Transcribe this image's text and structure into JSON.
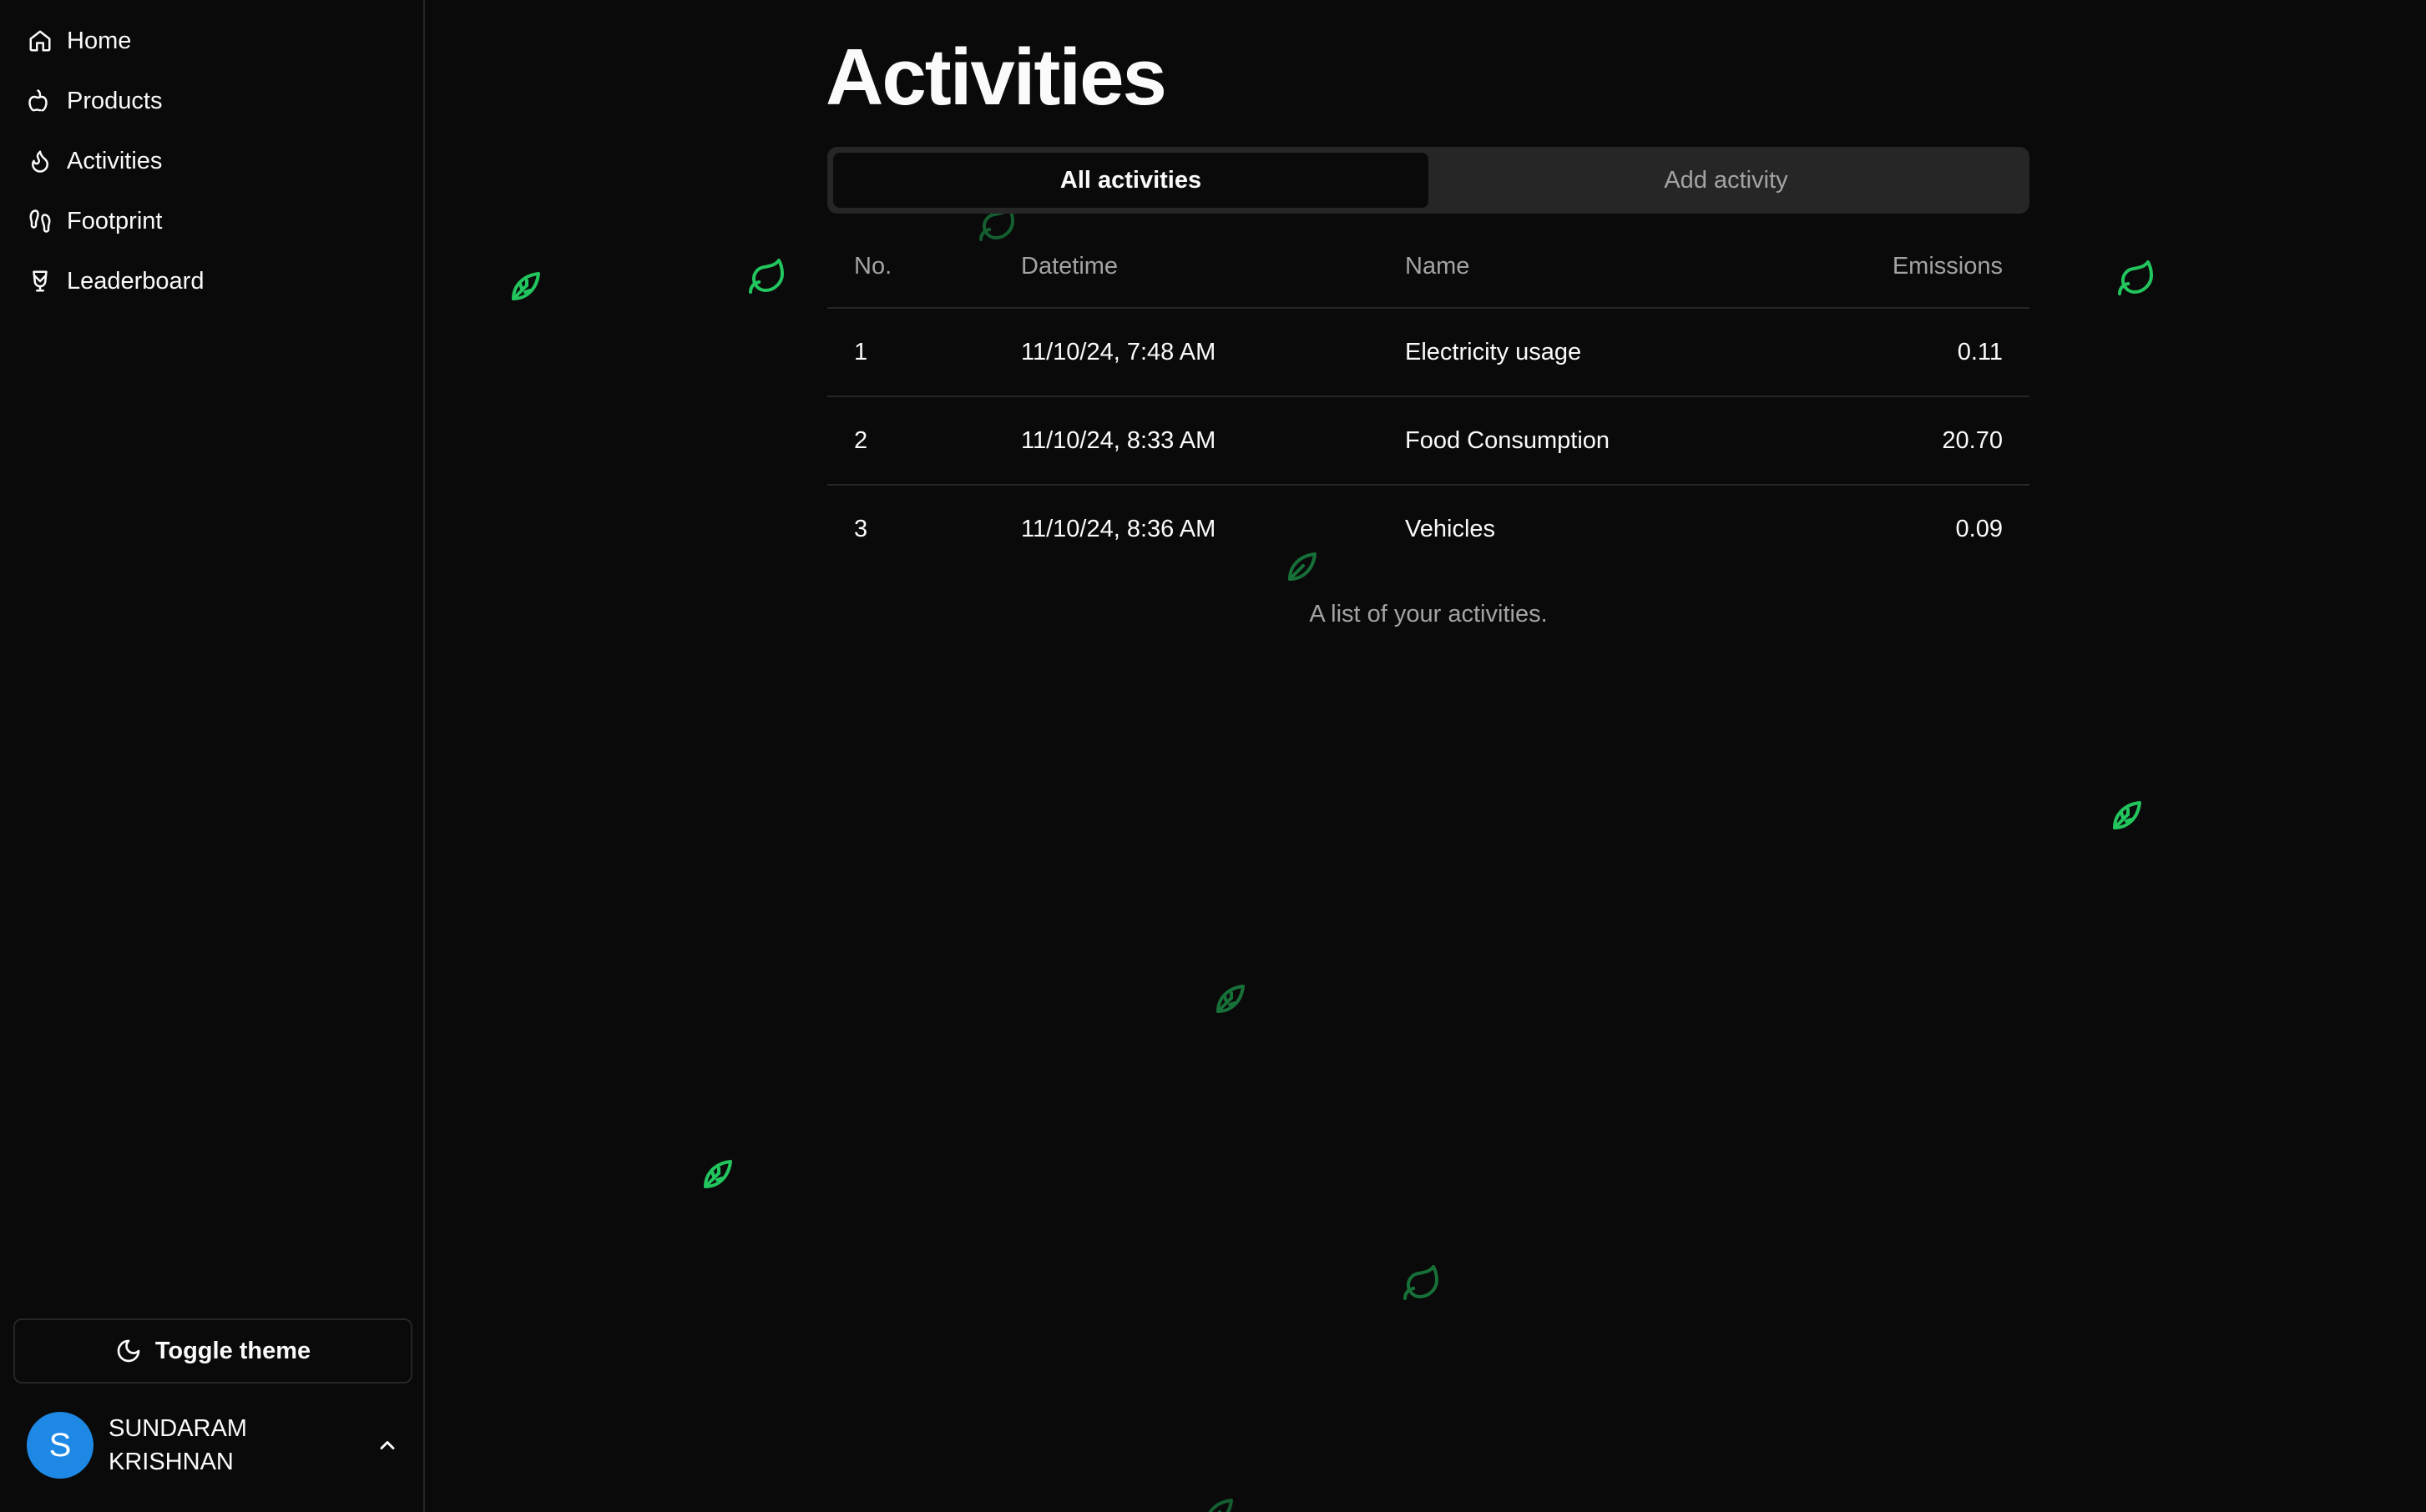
{
  "sidebar": {
    "nav": [
      {
        "label": "Home",
        "icon": "home-icon"
      },
      {
        "label": "Products",
        "icon": "apple-icon"
      },
      {
        "label": "Activities",
        "icon": "flame-icon"
      },
      {
        "label": "Footprint",
        "icon": "footprints-icon"
      },
      {
        "label": "Leaderboard",
        "icon": "trophy-icon"
      }
    ],
    "toggle_theme_label": "Toggle theme",
    "user": {
      "avatar_initial": "S",
      "name": "SUNDARAM KRISHNAN"
    }
  },
  "main": {
    "title": "Activities",
    "tabs": [
      {
        "label": "All activities",
        "active": true
      },
      {
        "label": "Add activity",
        "active": false
      }
    ],
    "table": {
      "headers": [
        "No.",
        "Datetime",
        "Name",
        "Emissions"
      ],
      "rows": [
        [
          "1",
          "11/10/24, 7:48 AM",
          "Electricity usage",
          "0.11"
        ],
        [
          "2",
          "11/10/24, 8:33 AM",
          "Food Consumption",
          "20.70"
        ],
        [
          "3",
          "11/10/24, 8:36 AM",
          "Vehicles",
          "0.09"
        ]
      ],
      "caption": "A list of your activities."
    }
  },
  "colors": {
    "background": "#0a0a0a",
    "border": "#262626",
    "muted_text": "#a3a3a3",
    "leaf_accent": "#22c55e",
    "avatar": "#1e88e5"
  }
}
